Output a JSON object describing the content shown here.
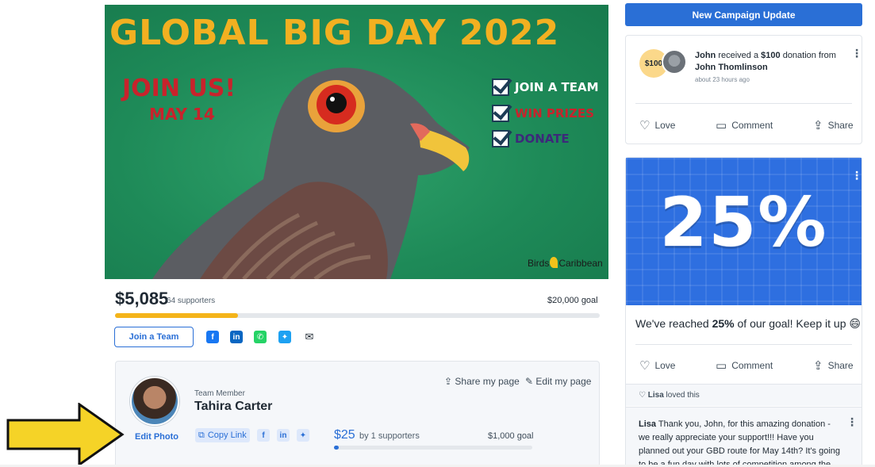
{
  "hero": {
    "title": "GLOBAL BIG DAY 2022",
    "join_us": "JOIN US!",
    "date": "MAY 14",
    "checklist": [
      {
        "label": "JOIN A TEAM",
        "color": "#ffffff"
      },
      {
        "label": "WIN PRIZES",
        "color": "#c8232c"
      },
      {
        "label": "DONATE",
        "color": "#3c2a7a"
      }
    ],
    "logo_left": "Birds",
    "logo_right": "Caribbean"
  },
  "campaign": {
    "raised": "$5,085",
    "supporters": "64 supporters",
    "goal": "$20,000 goal",
    "progress_fraction": 0.254,
    "join_team_label": "Join a Team",
    "share_icons": [
      {
        "name": "facebook-icon",
        "glyph": "f",
        "color": "#1877f2"
      },
      {
        "name": "linkedin-icon",
        "glyph": "in",
        "color": "#0a66c2"
      },
      {
        "name": "whatsapp-icon",
        "glyph": "✆",
        "color": "#25d366"
      },
      {
        "name": "twitter-icon",
        "glyph": "✦",
        "color": "#1da1f2"
      },
      {
        "name": "email-icon",
        "glyph": "✉",
        "color": "#1f2933"
      }
    ]
  },
  "member": {
    "role": "Team Member",
    "name": "Tahira Carter",
    "share_my_page": "Share my page",
    "edit_my_page": "Edit my page",
    "edit_photo": "Edit Photo",
    "copy_link": "Copy Link",
    "raised": "$25",
    "supporters": "by 1 supporters",
    "goal": "$1,000 goal",
    "progress_fraction": 0.025
  },
  "sidebar": {
    "new_update_label": "New Campaign Update",
    "donation": {
      "badge": "$100",
      "donor": "John",
      "middle": " received a ",
      "amount": "$100",
      "suffix": " donation from ",
      "from": "John Thomlinson",
      "time": "about 23 hours ago"
    },
    "actions": {
      "love": "Love",
      "comment": "Comment",
      "share": "Share"
    },
    "goal_update": {
      "banner_pct": "25%",
      "msg_prefix": "We've reached ",
      "msg_pct": "25%",
      "msg_suffix": " of our goal! Keep it up 😄",
      "love_name": "Lisa",
      "love_suffix": " loved this",
      "comment_author": "Lisa",
      "comment_body": "  Thank you, John, for this amazing donation - we really appreciate your support!!! Have you planned out your GBD route for May 14th? It's going to be a fun day with lots of competition among the teams!"
    }
  },
  "colors": {
    "accent": "#2a6fd6",
    "progress": "#f4b41a",
    "title_gold": "#f2b021",
    "alert_red": "#c8232c",
    "arrow_yellow": "#f5d327"
  }
}
